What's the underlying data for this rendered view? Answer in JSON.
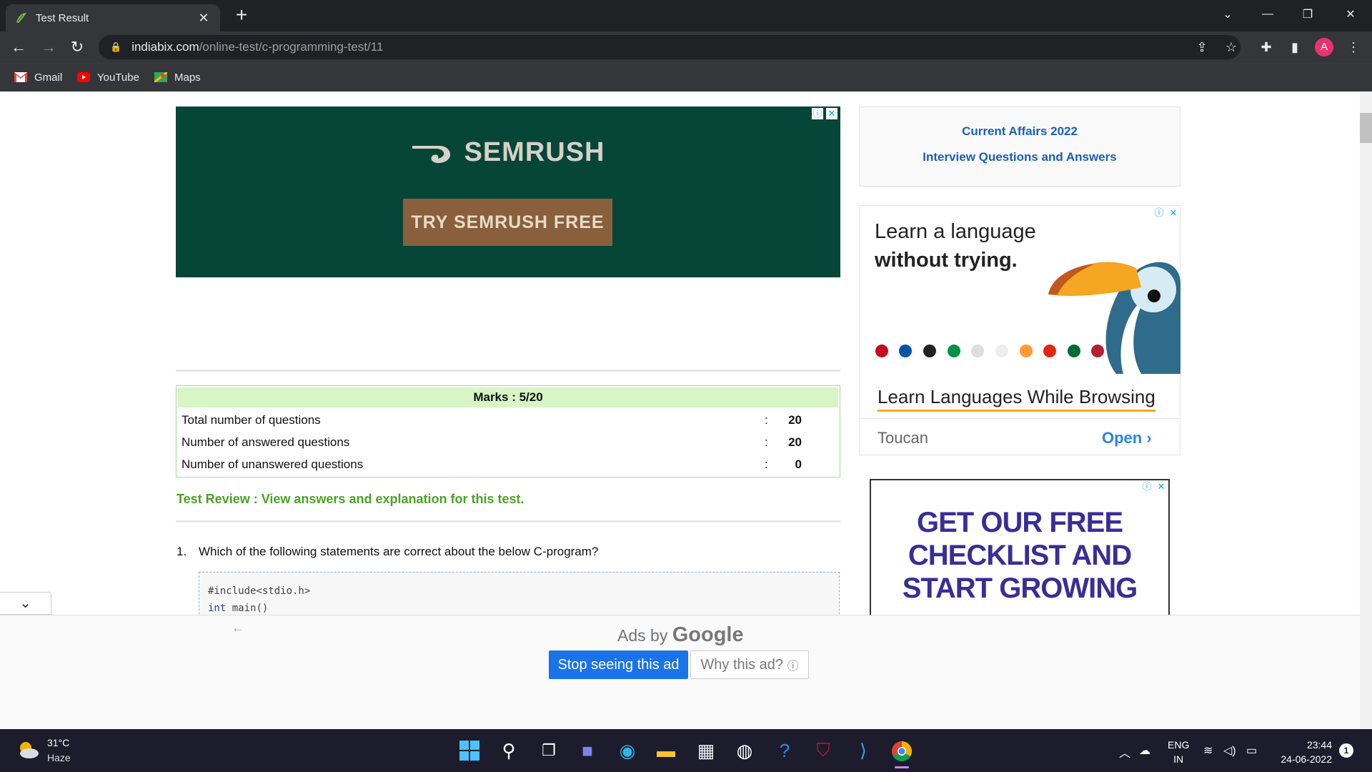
{
  "browser": {
    "tab_title": "Test Result",
    "tab_close": "✕",
    "new_tab": "+",
    "url_host": "indiabix.com",
    "url_path": "/online-test/c-programming-test/11",
    "profile_initial": "A",
    "bookmarks": [
      "Gmail",
      "YouTube",
      "Maps"
    ]
  },
  "ads": {
    "semrush_brand": "SEMRUSH",
    "semrush_cta": "TRY SEMRUSH FREE",
    "toucan_line1": "Learn a language",
    "toucan_line2": "without trying.",
    "toucan_headline": "Learn Languages While Browsing",
    "toucan_advertiser": "Toucan",
    "toucan_open": "Open",
    "checklist_text": "GET OUR FREE CHECKLIST AND START GROWING",
    "ads_by": "Ads by",
    "google": "Google",
    "stop_seeing": "Stop seeing this ad",
    "why_this_ad": "Why this ad?"
  },
  "sidebar": {
    "links": [
      "Current Affairs 2022",
      "Interview Questions and Answers"
    ]
  },
  "result": {
    "marks_heading": "Marks : 5/20",
    "rows": [
      {
        "label": "Total number of questions",
        "sep": ":",
        "value": "20"
      },
      {
        "label": "Number of answered questions",
        "sep": ":",
        "value": "20"
      },
      {
        "label": "Number of unanswered questions",
        "sep": ":",
        "value": "0"
      }
    ],
    "review_link": "Test Review : View answers and explanation for this test."
  },
  "question": {
    "number": "1.",
    "text": "Which of the following statements are correct about the below C-program?",
    "code_line1": "#include<stdio.h>",
    "code_line2_kw": "int",
    "code_line2_rest": " main()"
  },
  "taskbar": {
    "temperature": "31°C",
    "weather": "Haze",
    "lang1": "ENG",
    "lang2": "IN",
    "time": "23:44",
    "date": "24-06-2022",
    "notifications": "1"
  }
}
